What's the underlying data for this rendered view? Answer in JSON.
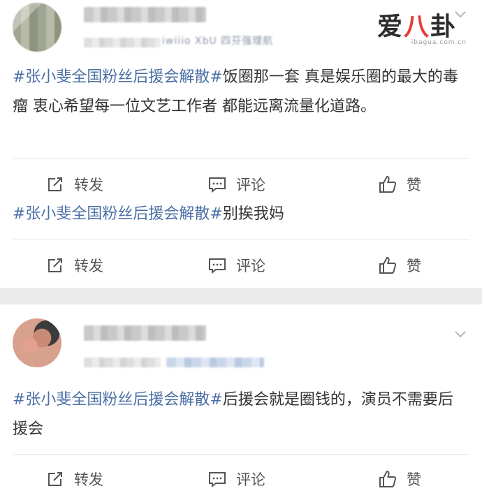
{
  "logo": {
    "text_left": "爱",
    "text_accent": "八",
    "text_right": "卦",
    "url": "ibagua.com.cn"
  },
  "posts": [
    {
      "meta_text": "iwiiio  XbU  四芬强理航",
      "hashtag": "#张小斐全国粉丝后援会解散#",
      "content": "饭圈那一套 真是娱乐圈的最大的毒瘤 衷心希望每一位文艺工作者 都能远离流量化道路。",
      "actions": {
        "repost": "转发",
        "comment": "评论",
        "like": "赞"
      }
    },
    {
      "hashtag": "#张小斐全国粉丝后援会解散#",
      "content": "别挨我妈",
      "actions": {
        "repost": "转发",
        "comment": "评论",
        "like": "赞"
      }
    },
    {
      "hashtag": "#张小斐全国粉丝后援会解散#",
      "content": "后援会就是圈钱的，演员不需要后援会",
      "actions": {
        "repost": "转发",
        "comment": "评论",
        "like": "赞"
      }
    }
  ],
  "colors": {
    "hashtag": "#4b6fa6",
    "text": "#333333",
    "separator": "#ebebeb"
  }
}
